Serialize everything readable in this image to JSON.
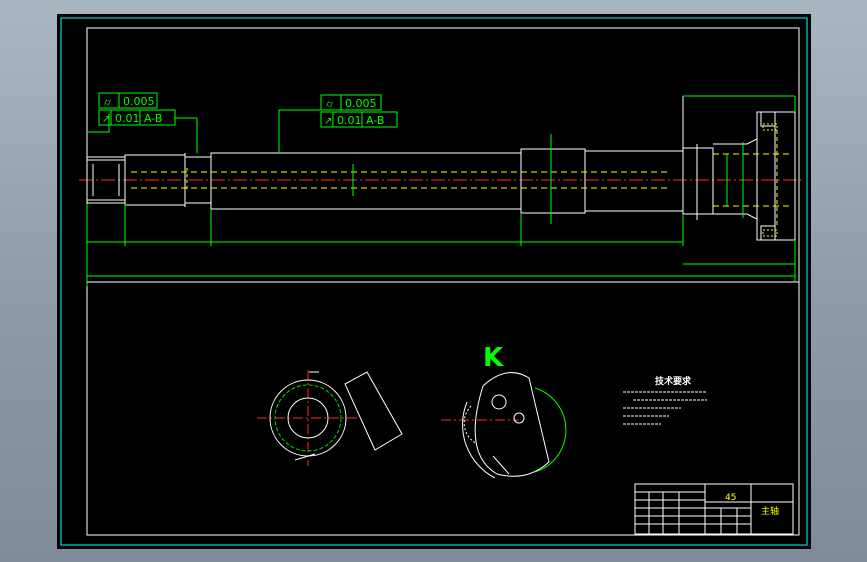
{
  "gdt": [
    {
      "symbol": "cylindricity-icon",
      "tolerance": "0.005",
      "runout_tolerance": "0.01",
      "datum": "A-B"
    },
    {
      "symbol": "cylindricity-icon",
      "tolerance": "0.005",
      "runout_tolerance": "0.01",
      "datum": "A-B"
    }
  ],
  "section_label": "K",
  "tech_requirements": {
    "heading": "技术要求"
  },
  "title_block": {
    "material": "45",
    "part_name": "主轴"
  },
  "colors": {
    "outline": "#ffffff",
    "dimension": "#00ff00",
    "centerline": "#ff2a2a",
    "hidden": "#ffff00",
    "frame": "#00ffff"
  }
}
